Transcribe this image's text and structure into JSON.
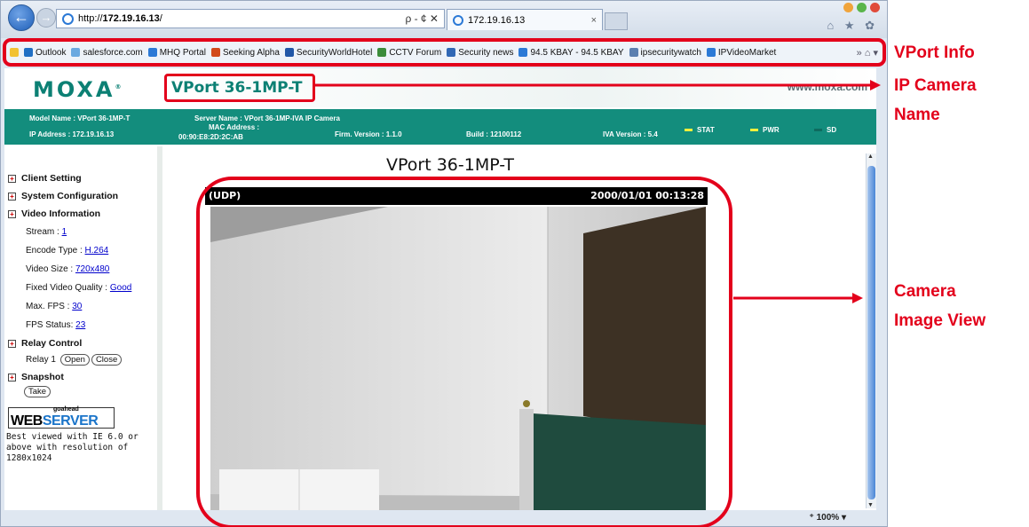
{
  "browser": {
    "address_plain": "http://",
    "address_bold": "172.19.16.13",
    "address_tail": "/",
    "address_tools": "ρ - ¢ ✕",
    "tab_title": "172.19.16.13",
    "tab_close": "×",
    "home_icons": "⌂ ★ ✿",
    "favorites": [
      {
        "label": "Outlook",
        "color": "#1f6fc4"
      },
      {
        "label": "salesforce.com",
        "color": "#6aa9e0"
      },
      {
        "label": "MHQ Portal",
        "color": "#2b79d6"
      },
      {
        "label": "Seeking Alpha",
        "color": "#d24a1a"
      },
      {
        "label": "SecurityWorldHotel",
        "color": "#2157a7"
      },
      {
        "label": "CCTV Forum",
        "color": "#3b8c3b"
      },
      {
        "label": "Security news",
        "color": "#3168b5"
      },
      {
        "label": "94.5 KBAY - 94.5 KBAY",
        "color": "#2b79d6"
      },
      {
        "label": "ipsecuritywatch",
        "color": "#5b7fb0"
      },
      {
        "label": "IPVideoMarket",
        "color": "#2b79d6"
      }
    ],
    "fav_tools": "»   ⌂ ▾",
    "zoom": "100%"
  },
  "page": {
    "logo": "MOXA",
    "logo_mark": "®",
    "camera_name": "VPort 36-1MP-T",
    "moxa_url": "www.moxa.com",
    "info": {
      "model_name": "Model Name : VPort 36-1MP-T",
      "ip_address": "IP Address : 172.19.16.13",
      "server_name": "Server Name : VPort 36-1MP-IVA IP Camera",
      "mac_label": "MAC Address :",
      "mac_value": "00:90:E8:2D:2C:AB",
      "firm_version": "Firm. Version : 1.1.0",
      "build": "Build : 12100112",
      "iva_version": "IVA Version : 5.4",
      "stat": "STAT",
      "pwr": "PWR",
      "sd": "SD",
      "stat_color": "#f2ef3c",
      "pwr_color": "#f2ef3c",
      "sd_color": "#0e6b5f"
    },
    "sidebar": {
      "client_setting": "Client Setting",
      "system_configuration": "System Configuration",
      "video_information": "Video Information",
      "stream_label": "Stream : ",
      "stream_value": "1",
      "encode_label": "Encode Type : ",
      "encode_value": "H.264",
      "video_size_label": "Video Size : ",
      "video_size_value": "720x480",
      "quality_label": "Fixed Video Quality : ",
      "quality_value": "Good",
      "max_fps_label": "Max. FPS : ",
      "max_fps_value": "30",
      "fps_status_label": "FPS Status: ",
      "fps_status_value": "23",
      "relay_control": "Relay Control",
      "relay_label": "Relay 1",
      "relay_open": "Open",
      "relay_close": "Close",
      "snapshot": "Snapshot",
      "snapshot_take": "Take",
      "webserver_small": "goahead",
      "webserver_web": "WEB",
      "webserver_server": "SERVER",
      "best_viewed": "Best viewed with IE 6.0 or above with resolution of 1280x1024"
    },
    "main_title": "VPort 36-1MP-T",
    "video_bar_left": "(UDP)",
    "video_bar_right": "2000/01/01 00:13:28"
  },
  "callouts": {
    "vport_info": "VPort Info",
    "ip_camera_name_1": "IP Camera",
    "ip_camera_name_2": "Name",
    "camera_image_view_1": "Camera",
    "camera_image_view_2": "Image View"
  },
  "colors": {
    "accent_red": "#e3001b",
    "moxa_teal": "#0c8074",
    "info_bar": "#138d7d"
  }
}
